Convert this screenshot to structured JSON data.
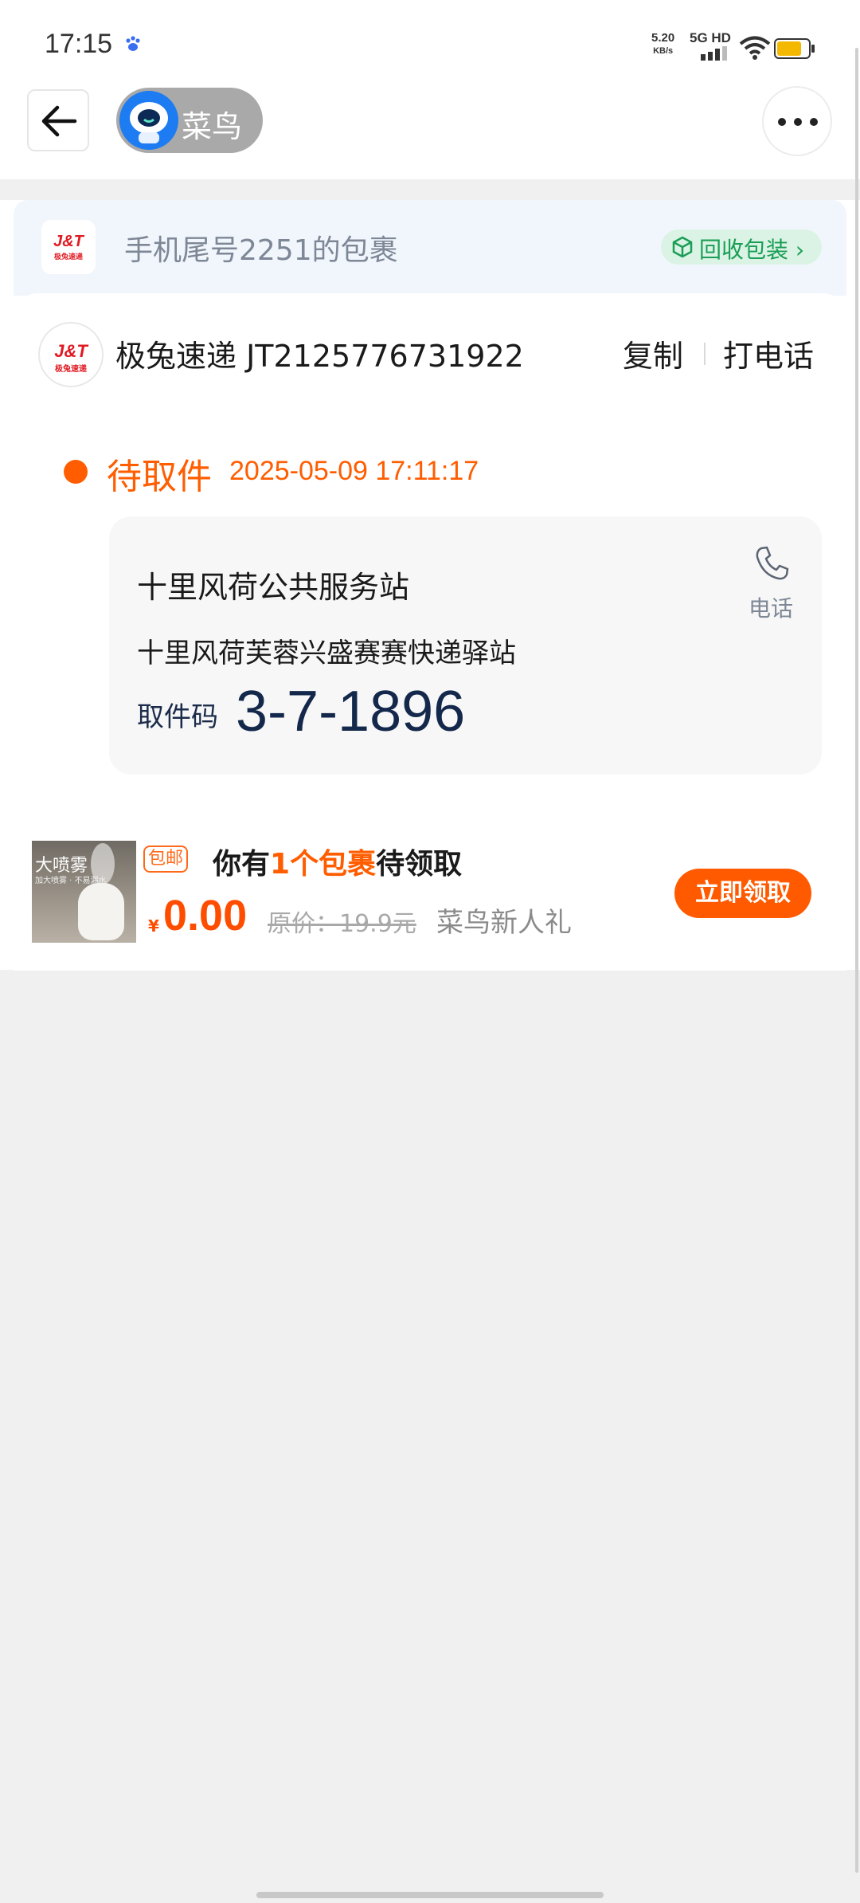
{
  "status_bar": {
    "time": "17:15",
    "speed_value": "5.20",
    "speed_unit": "KB/s",
    "network": "5G HD",
    "icons": [
      "baidu-paw-icon",
      "signal-icon",
      "wifi-icon",
      "battery-icon"
    ]
  },
  "nav": {
    "back_icon": "arrow-left-icon",
    "mini_program_title": "菜鸟",
    "more_icon": "more-dots-icon"
  },
  "package": {
    "header_title": "手机尾号2251的包裹",
    "recycle_label": "回收包装",
    "courier_logo_text": "J&T",
    "courier_logo_sub": "极兔速递",
    "courier_line": "极兔速递 JT2125776731922",
    "copy_label": "复制",
    "call_label": "打电话",
    "status": "待取件",
    "status_time": "2025-05-09 17:11:17",
    "station_name": "十里风荷公共服务站",
    "station_sub": "十里风荷芙蓉兴盛赛赛快递驿站",
    "pickup_code_label": "取件码",
    "pickup_code": "3-7-1896",
    "phone_label": "电话"
  },
  "promo": {
    "image_label": "大喷雾",
    "image_sub": "加大喷雾 · 不易漏水",
    "free_shipping_tag": "包邮",
    "title_prefix": "你有",
    "title_highlight": "1个包裹",
    "title_suffix": "待领取",
    "currency": "¥",
    "price": "0.00",
    "original_price": "原价：19.9元",
    "newbie_label": "菜鸟新人礼",
    "claim_button": "立即领取"
  },
  "colors": {
    "accent_orange": "#ff5d00",
    "green": "#1a9e55",
    "code_navy": "#14284b",
    "brand_red": "#e01a22"
  }
}
